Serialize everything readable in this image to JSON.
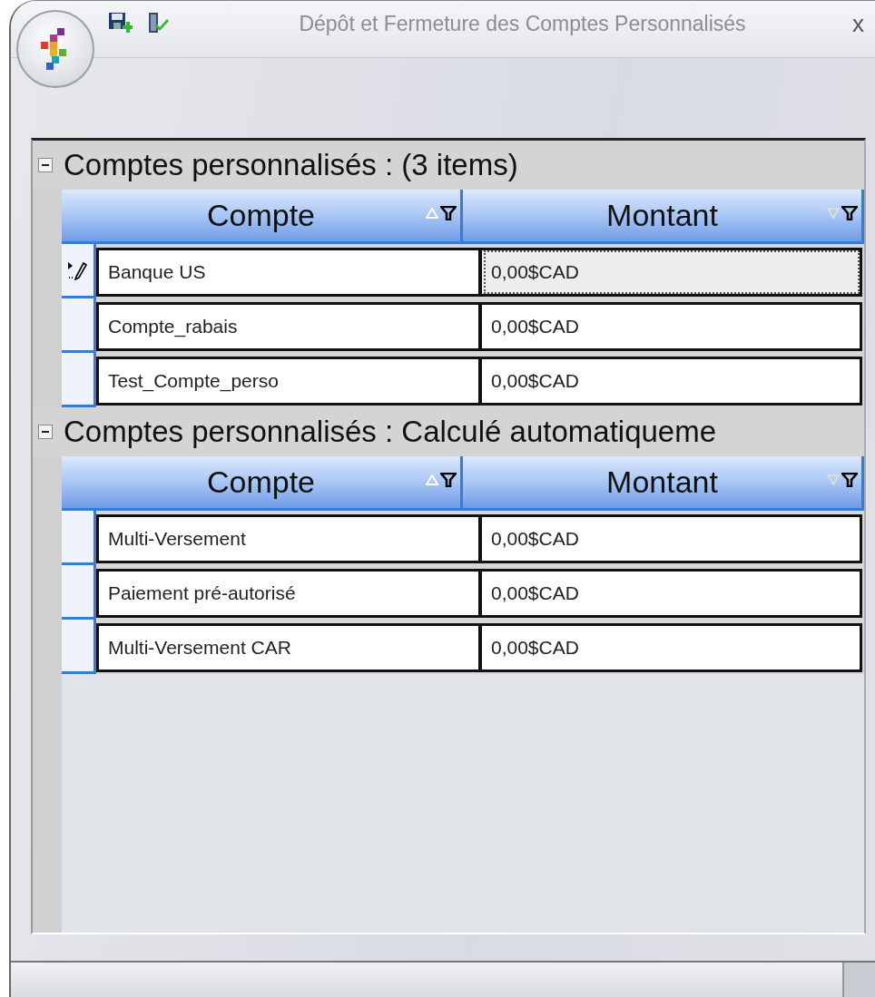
{
  "window": {
    "title": "Dépôt et Fermeture des Comptes Personnalisés",
    "close": "x"
  },
  "groups": [
    {
      "title": "Comptes personnalisés :  (3 items)",
      "expanded": true,
      "columns": [
        {
          "label": "Compte",
          "sort_ascending": true
        },
        {
          "label": "Montant",
          "sort_ascending": false
        }
      ],
      "rows": [
        {
          "compte": "Banque US",
          "montant": "0,00$CAD",
          "selected": true
        },
        {
          "compte": "Compte_rabais",
          "montant": "0,00$CAD",
          "selected": false
        },
        {
          "compte": "Test_Compte_perso",
          "montant": "0,00$CAD",
          "selected": false
        }
      ]
    },
    {
      "title": "Comptes personnalisés : Calculé automatiqueme",
      "expanded": true,
      "columns": [
        {
          "label": "Compte",
          "sort_ascending": true
        },
        {
          "label": "Montant",
          "sort_ascending": false
        }
      ],
      "rows": [
        {
          "compte": "Multi-Versement",
          "montant": "0,00$CAD",
          "selected": false
        },
        {
          "compte": "Paiement pré-autorisé",
          "montant": "0,00$CAD",
          "selected": false
        },
        {
          "compte": "Multi-Versement CAR",
          "montant": "0,00$CAD",
          "selected": false
        }
      ]
    }
  ]
}
